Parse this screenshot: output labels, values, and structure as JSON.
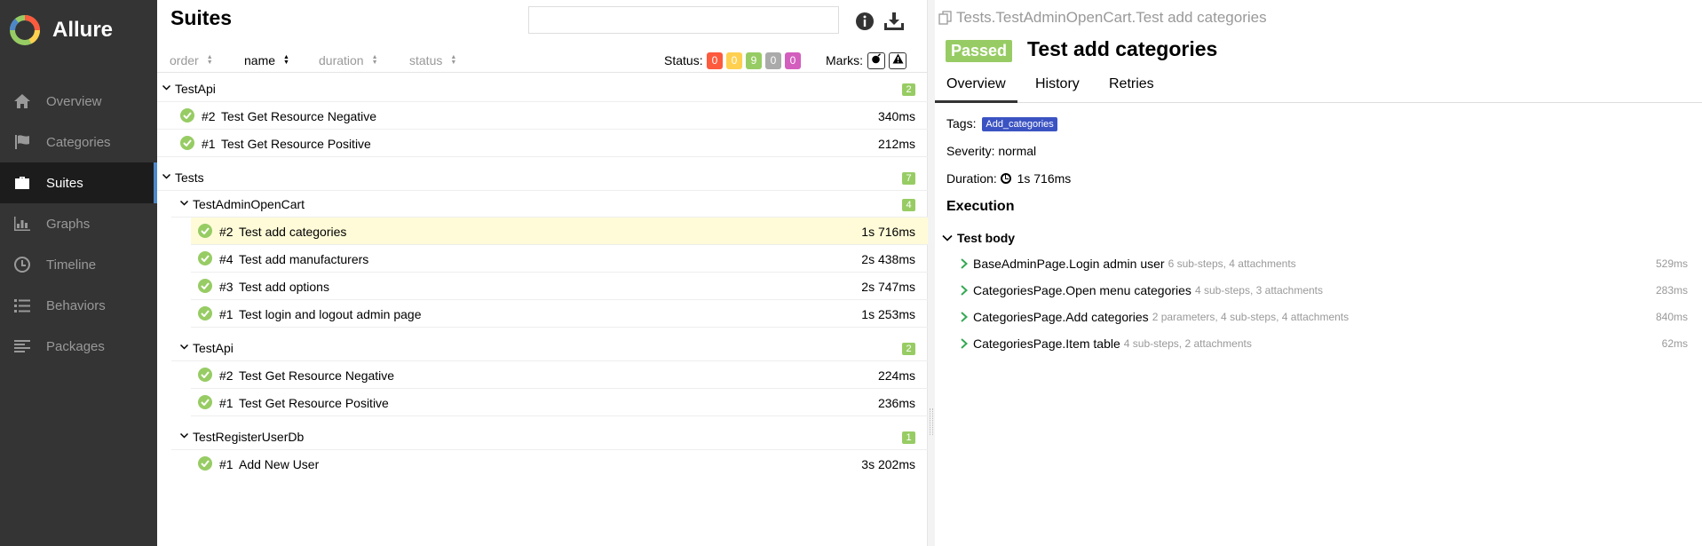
{
  "sidebar": {
    "brand": "Allure",
    "items": [
      {
        "label": "Overview",
        "icon": "home-icon"
      },
      {
        "label": "Categories",
        "icon": "flag-icon"
      },
      {
        "label": "Suites",
        "icon": "briefcase-icon",
        "active": true
      },
      {
        "label": "Graphs",
        "icon": "bar-chart-icon"
      },
      {
        "label": "Timeline",
        "icon": "clock-icon"
      },
      {
        "label": "Behaviors",
        "icon": "list-icon"
      },
      {
        "label": "Packages",
        "icon": "align-left-icon"
      }
    ]
  },
  "suites": {
    "title": "Suites",
    "search_value": "",
    "sort": {
      "order": "order",
      "name": "name",
      "duration": "duration",
      "status": "status"
    },
    "status_label": "Status:",
    "status_counts": [
      {
        "value": "0",
        "color": "#fd5a3e"
      },
      {
        "value": "0",
        "color": "#ffd050"
      },
      {
        "value": "9",
        "color": "#97cc64"
      },
      {
        "value": "0",
        "color": "#aaaaaa"
      },
      {
        "value": "0",
        "color": "#d35ebe"
      }
    ],
    "marks_label": "Marks:",
    "groups": {
      "testapi_top": {
        "name": "TestApi",
        "count": "2",
        "tests": [
          {
            "num": "#2",
            "name": "Test Get Resource Negative",
            "duration": "340ms"
          },
          {
            "num": "#1",
            "name": "Test Get Resource Positive",
            "duration": "212ms"
          }
        ]
      },
      "tests": {
        "name": "Tests",
        "count": "7"
      },
      "admin": {
        "name": "TestAdminOpenCart",
        "count": "4",
        "tests": [
          {
            "num": "#2",
            "name": "Test add categories",
            "duration": "1s 716ms"
          },
          {
            "num": "#4",
            "name": "Test add manufacturers",
            "duration": "2s 438ms"
          },
          {
            "num": "#3",
            "name": "Test add options",
            "duration": "2s 747ms"
          },
          {
            "num": "#1",
            "name": "Test login and logout admin page",
            "duration": "1s 253ms"
          }
        ]
      },
      "testapi_sub": {
        "name": "TestApi",
        "count": "2",
        "tests": [
          {
            "num": "#2",
            "name": "Test Get Resource Negative",
            "duration": "224ms"
          },
          {
            "num": "#1",
            "name": "Test Get Resource Positive",
            "duration": "236ms"
          }
        ]
      },
      "register": {
        "name": "TestRegisterUserDb",
        "count": "1",
        "tests": [
          {
            "num": "#1",
            "name": "Add New User",
            "duration": "3s 202ms"
          }
        ]
      }
    }
  },
  "detail": {
    "breadcrumb": "Tests.TestAdminOpenCart.Test add categories",
    "status": "Passed",
    "title": "Test add categories",
    "tabs": [
      "Overview",
      "History",
      "Retries"
    ],
    "tags_label": "Tags:",
    "tag": "Add_categories",
    "severity": "Severity: normal",
    "duration_label": "Duration:",
    "duration": "1s 716ms",
    "execution_title": "Execution",
    "test_body": "Test body",
    "steps": [
      {
        "name": "BaseAdminPage.Login admin user",
        "meta": "6 sub-steps, 4 attachments",
        "duration": "529ms"
      },
      {
        "name": "CategoriesPage.Open menu categories",
        "meta": "4 sub-steps, 3 attachments",
        "duration": "283ms"
      },
      {
        "name": "CategoriesPage.Add categories",
        "meta": "2 parameters, 4 sub-steps, 4 attachments",
        "duration": "840ms"
      },
      {
        "name": "CategoriesPage.Item table",
        "meta": "4 sub-steps, 2 attachments",
        "duration": "62ms"
      }
    ]
  }
}
